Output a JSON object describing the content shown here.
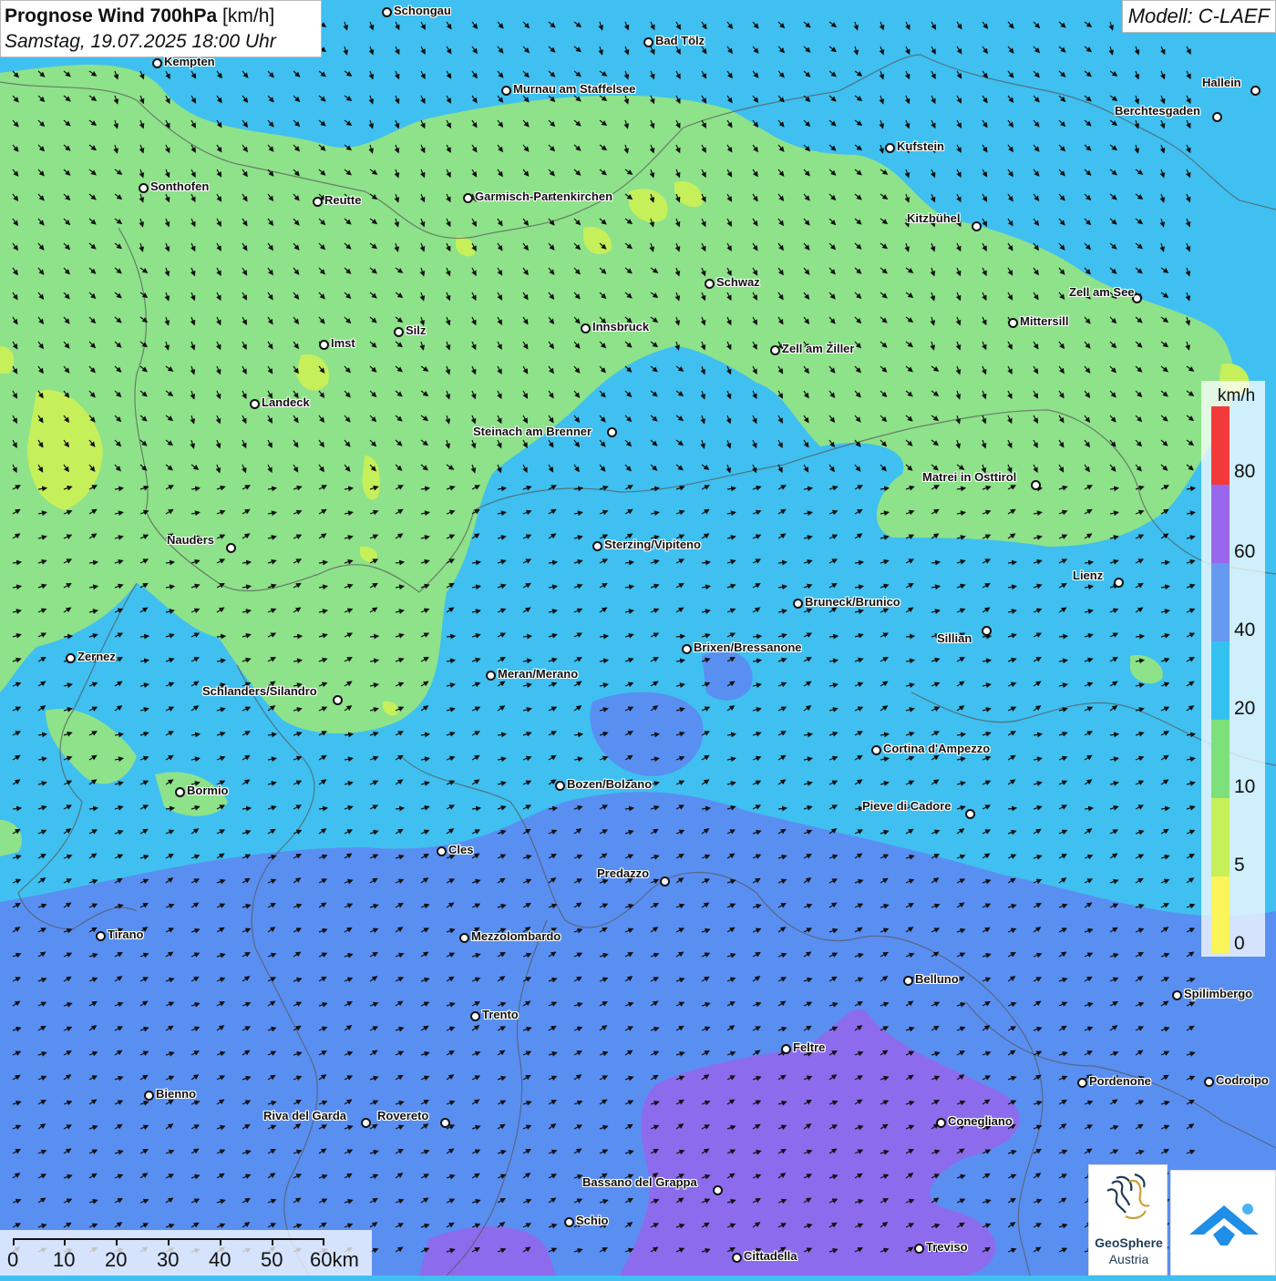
{
  "title": {
    "main": "Prognose Wind 700hPa",
    "unit": "[km/h]",
    "subtitle": "Samstag, 19.07.2025 18:00 Uhr"
  },
  "model": {
    "label": "Modell: C-LAEF"
  },
  "legend": {
    "unit": "km/h",
    "labels": [
      "80",
      "60",
      "40",
      "20",
      "10",
      "5",
      "0"
    ],
    "colors": [
      "#f23a3a",
      "#9966ee",
      "#6699f0",
      "#33c2f0",
      "#7ee07a",
      "#c5f05a",
      "#fbf55a"
    ]
  },
  "scale": {
    "labels": [
      "0",
      "10",
      "20",
      "30",
      "40",
      "50",
      "60km"
    ]
  },
  "logos": {
    "geosphere_name": "GeoSphere",
    "geosphere_sub": "Austria"
  },
  "colors": {
    "calm_green": "#8ee28a",
    "cyan": "#3fc0f0",
    "blue": "#5a8ff2",
    "purple": "#8c6cec"
  },
  "cities": [
    {
      "name": "Schongau"
    },
    {
      "name": "Bad Tölz"
    },
    {
      "name": "Kempten"
    },
    {
      "name": "Hallein"
    },
    {
      "name": "Murnau am Staffelsee"
    },
    {
      "name": "Berchtesgaden"
    },
    {
      "name": "Kufstein"
    },
    {
      "name": "Sonthofen"
    },
    {
      "name": "Reutte"
    },
    {
      "name": "Garmisch-Partenkirchen"
    },
    {
      "name": "Kitzbühel"
    },
    {
      "name": "Schwaz"
    },
    {
      "name": "Zell am See"
    },
    {
      "name": "Mittersill"
    },
    {
      "name": "Silz"
    },
    {
      "name": "Innsbruck"
    },
    {
      "name": "Imst"
    },
    {
      "name": "Zell am Ziller"
    },
    {
      "name": "Landeck"
    },
    {
      "name": "Steinach am Brenner"
    },
    {
      "name": "Matrei in Osttirol"
    },
    {
      "name": "Nauders"
    },
    {
      "name": "Sterzing/Vipiteno"
    },
    {
      "name": "Lienz"
    },
    {
      "name": "Bruneck/Brunico"
    },
    {
      "name": "Sillian"
    },
    {
      "name": "Zernez"
    },
    {
      "name": "Brixen/Bressanone"
    },
    {
      "name": "Meran/Merano"
    },
    {
      "name": "Schlanders/Silandro"
    },
    {
      "name": "Cortina d'Ampezzo"
    },
    {
      "name": "Bozen/Bolzano"
    },
    {
      "name": "Bormio"
    },
    {
      "name": "Pieve di Cadore"
    },
    {
      "name": "Cles"
    },
    {
      "name": "Predazzo"
    },
    {
      "name": "Tirano"
    },
    {
      "name": "Mezzolombardo"
    },
    {
      "name": "Belluno"
    },
    {
      "name": "Spilimbergo"
    },
    {
      "name": "Trento"
    },
    {
      "name": "Feltre"
    },
    {
      "name": "Pordenone"
    },
    {
      "name": "Codroipo"
    },
    {
      "name": "Bienno"
    },
    {
      "name": "Riva del Garda"
    },
    {
      "name": "Rovereto"
    },
    {
      "name": "Conegliano"
    },
    {
      "name": "Bassano del Grappa"
    },
    {
      "name": "Schio"
    },
    {
      "name": "Treviso"
    },
    {
      "name": "Cittadella"
    }
  ]
}
